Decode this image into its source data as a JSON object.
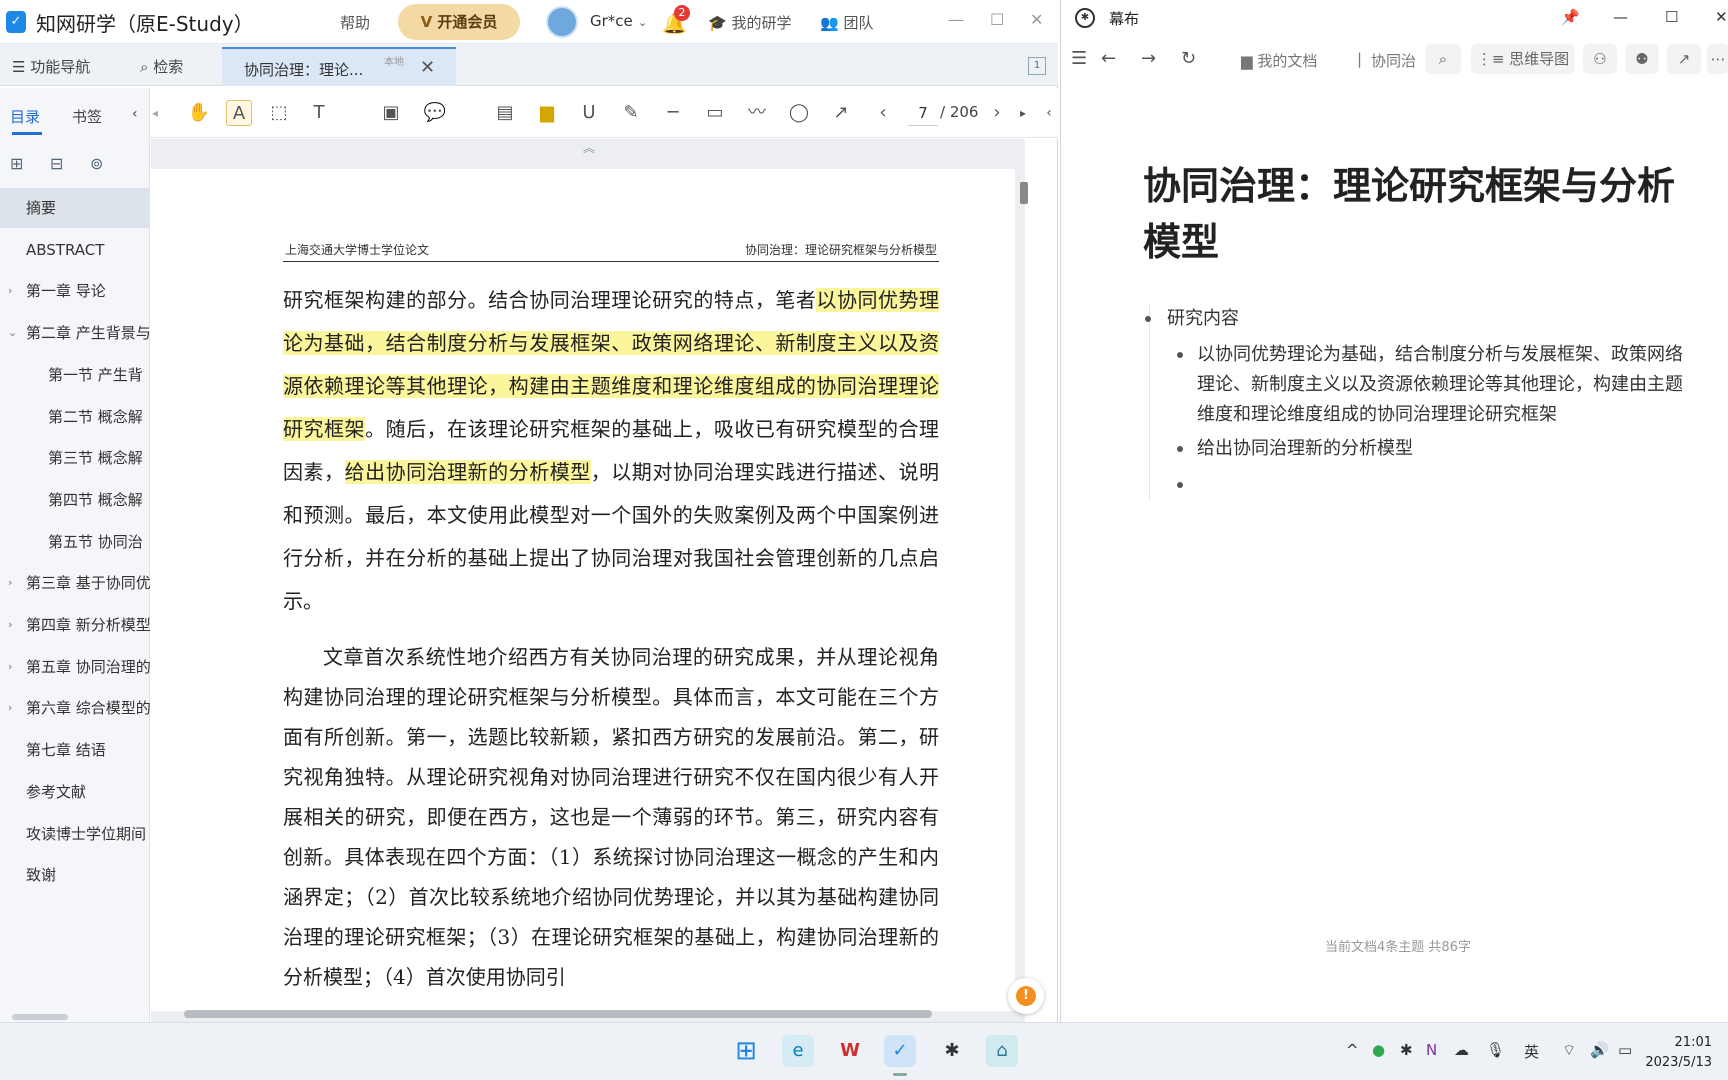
{
  "estudy": {
    "app_title": "知网研学（原E-Study）",
    "help": "帮助",
    "vip_button": "开通会员",
    "user_name": "Gr*ce",
    "notification_count": "2",
    "my_research": "我的研学",
    "team": "团队",
    "tabs": {
      "nav": "功能导航",
      "search": "检索",
      "doc_tab_label": "协同治理：理论...",
      "doc_tab_local": "本地",
      "page_indicator": "1"
    },
    "toolbar": {
      "current_page": "7",
      "total_pages": "/ 206"
    },
    "sidebar": {
      "tab_toc": "目录",
      "tab_bookmark": "书签",
      "toc": [
        {
          "label": "摘要",
          "caret": ""
        },
        {
          "label": "ABSTRACT",
          "caret": ""
        },
        {
          "label": "第一章 导论",
          "caret": "›"
        },
        {
          "label": "第二章 产生背景与",
          "caret": "⌄"
        },
        {
          "label": "第一节 产生背",
          "caret": ""
        },
        {
          "label": "第二节 概念解",
          "caret": ""
        },
        {
          "label": "第三节 概念解",
          "caret": ""
        },
        {
          "label": "第四节 概念解",
          "caret": ""
        },
        {
          "label": "第五节 协同治",
          "caret": ""
        },
        {
          "label": "第三章 基于协同优",
          "caret": "›"
        },
        {
          "label": "第四章 新分析模型",
          "caret": "›"
        },
        {
          "label": "第五章 协同治理的",
          "caret": "›"
        },
        {
          "label": "第六章 综合模型的",
          "caret": "›"
        },
        {
          "label": "第七章 结语",
          "caret": ""
        },
        {
          "label": "参考文献",
          "caret": ""
        },
        {
          "label": "攻读博士学位期间",
          "caret": ""
        },
        {
          "label": "致谢",
          "caret": ""
        }
      ]
    },
    "document": {
      "header_left": "上海交通大学博士学位论文",
      "header_right": "协同治理：理论研究框架与分析模型",
      "p1_a": "研究框架构建的部分。结合协同治理理论研究的特点，笔者",
      "p1_hl1": "以协同优势理论为基础，结合制度分析与发展框架、政策网络理论、新制度主义以及资源依赖理论等其他理论，构建由主题维度和理论维度组成的协同治理理论研究框架",
      "p1_b": "。随后，在该理论研究框架的基础上，吸收已有研究模型的合理因素，",
      "p1_hl2": "给出协同治理新的分析模型",
      "p1_c": "，以期对协同治理实践进行描述、说明和预测。最后，本文使用此模型对一个国外的失败案例及两个中国案例进行分析，并在分析的基础上提出了协同治理对我国社会管理创新的几点启示。",
      "p2": "文章首次系统性地介绍西方有关协同治理的研究成果，并从理论视角构建协同治理的理论研究框架与分析模型。具体而言，本文可能在三个方面有所创新。第一，选题比较新颖，紧扣西方研究的发展前沿。第二，研究视角独特。从理论研究视角对协同治理进行研究不仅在国内很少有人开展相关的研究，即便在西方，这也是一个薄弱的环节。第三，研究内容有创新。具体表现在四个方面：（1）系统探讨协同治理这一概念的产生和内涵界定；（2）首次比较系统地介绍协同优势理论，并以其为基础构建协同治理的理论研究框架；（3）在理论研究框架的基础上，构建协同治理新的分析模型；（4）首次使用协同引"
    }
  },
  "mubu": {
    "window_title": "幕布",
    "nav_my_docs": "我的文档",
    "nav_breadcrumb": "协同治",
    "mindmap_button": "思维导图",
    "doc_title": "协同治理：理论研究框架与分析模型",
    "outline": {
      "root": "研究内容",
      "children": [
        "以协同优势理论为基础，结合制度分析与发展框架、政策网络理论、新制度主义以及资源依赖理论等其他理论，构建由主题维度和理论维度组成的协同治理理论研究框架",
        "给出协同治理新的分析模型",
        ""
      ]
    },
    "status": "当前文档4条主题 共86字"
  },
  "taskbar": {
    "ime": "英",
    "time": "21:01",
    "date": "2023/5/13"
  },
  "colors": {
    "highlight": "#fbf59c",
    "accent_blue": "#1f6fd6",
    "vip_gold": "#f3d9a4",
    "badge_red": "#e53935"
  }
}
